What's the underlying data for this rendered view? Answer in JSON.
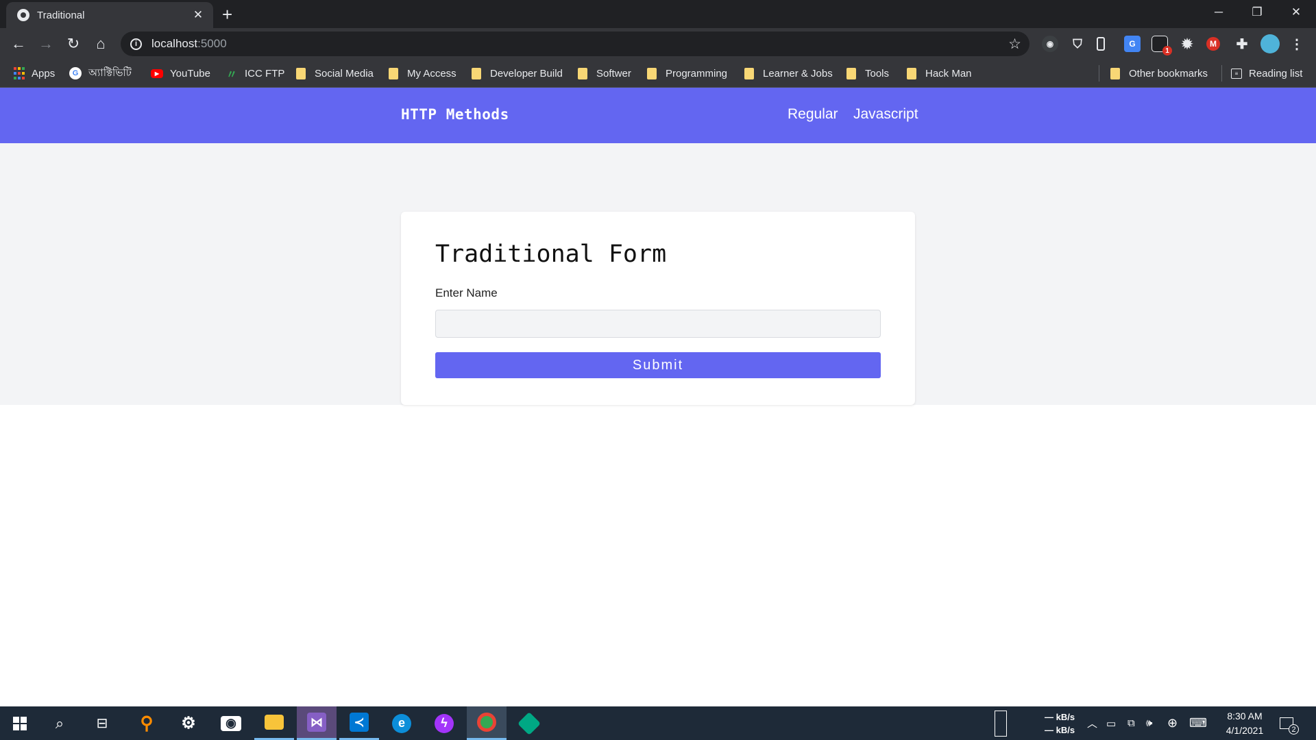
{
  "browser": {
    "tab_title": "Traditional",
    "tab_close": "✕",
    "new_tab": "+",
    "window_controls": {
      "minimize": "─",
      "restore": "❐",
      "close": "✕"
    },
    "url_host": "localhost",
    "url_port": ":5000",
    "info_glyph": "i",
    "ext_badge": "1",
    "bookmarks": [
      {
        "label": "Apps",
        "icon": "apps-grid-icon"
      },
      {
        "label": "অ্যাক্টিভিটি",
        "icon": "google-icon"
      },
      {
        "label": "YouTube",
        "icon": "youtube-icon"
      },
      {
        "label": "ICC FTP",
        "icon": "icc-icon"
      },
      {
        "label": "Social Media",
        "icon": "folder-icon"
      },
      {
        "label": "My Access",
        "icon": "folder-icon"
      },
      {
        "label": "Developer Build",
        "icon": "folder-icon"
      },
      {
        "label": "Softwer",
        "icon": "folder-icon"
      },
      {
        "label": "Programming",
        "icon": "folder-icon"
      },
      {
        "label": "Learner & Jobs",
        "icon": "folder-icon"
      },
      {
        "label": "Tools",
        "icon": "folder-icon"
      },
      {
        "label": "Hack Man",
        "icon": "folder-icon"
      }
    ],
    "other_bookmarks": "Other bookmarks",
    "reading_list": "Reading list"
  },
  "site": {
    "brand": "HTTP Methods",
    "nav": [
      "Regular",
      "Javascript"
    ],
    "accent_color": "#6366f1"
  },
  "form": {
    "title": "Traditional Form",
    "name_label": "Enter Name",
    "name_value": "",
    "submit_label": "Submit"
  },
  "taskbar": {
    "net_up": "— kB/s",
    "net_down": "— kB/s",
    "time": "8:30 AM",
    "date": "4/1/2021",
    "notifications": "2"
  }
}
